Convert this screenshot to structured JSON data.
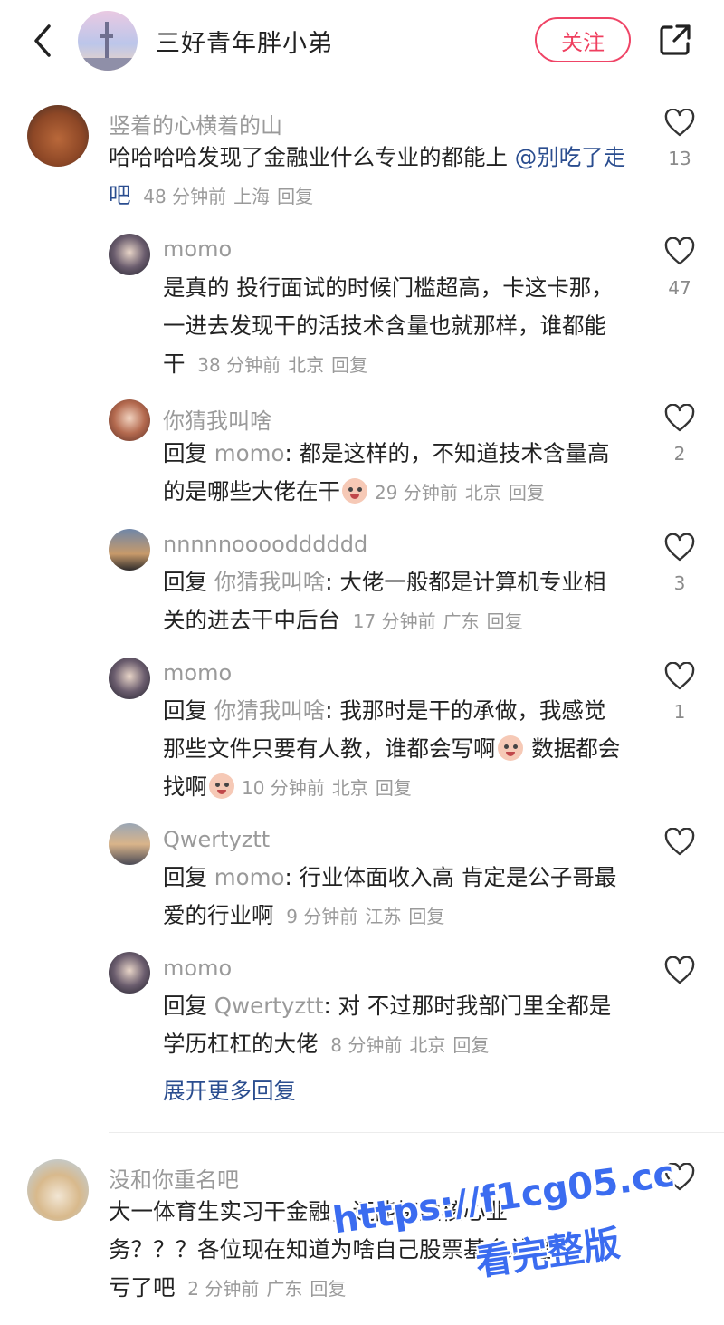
{
  "header": {
    "title": "三好青年胖小弟",
    "follow_label": "关注"
  },
  "comments": [
    {
      "name": "竖着的心横着的山",
      "text": "哈哈哈哈发现了金融业什么专业的都能上",
      "mention": "@别吃了走吧",
      "time": "48 分钟前",
      "location": "上海",
      "reply": "回复",
      "likes": "13"
    }
  ],
  "replies": [
    {
      "name": "momo",
      "text": "是真的 投行面试的时候门槛超高，卡这卡那，一进去发现干的活技术含量也就那样，谁都能干",
      "time": "38 分钟前",
      "location": "北京",
      "reply": "回复",
      "likes": "47"
    },
    {
      "name": "你猜我叫啥",
      "prefix": "回复",
      "target": "momo",
      "text": ": 都是这样的，不知道技术含量高的是哪些大佬在干",
      "time": "29 分钟前",
      "location": "北京",
      "reply": "回复",
      "likes": "2"
    },
    {
      "name": "nnnnnoooodddddd",
      "prefix": "回复",
      "target": "你猜我叫啥",
      "text": ": 大佬一般都是计算机专业相关的进去干中后台",
      "time": "17 分钟前",
      "location": "广东",
      "reply": "回复",
      "likes": "3"
    },
    {
      "name": "momo",
      "prefix": "回复",
      "target": "你猜我叫啥",
      "text": ": 我那时是干的承做，我感觉那些文件只要有人教，谁都会写啊",
      "text2": " 数据都会找啊",
      "time": "10 分钟前",
      "location": "北京",
      "reply": "回复",
      "likes": "1"
    },
    {
      "name": "Qwertyztt",
      "prefix": "回复",
      "target": "momo",
      "text": ": 行业体面收入高 肯定是公子哥最爱的行业啊",
      "time": "9 分钟前",
      "location": "江苏",
      "reply": "回复"
    },
    {
      "name": "momo",
      "prefix": "回复",
      "target": "Qwertyztt",
      "text": ": 对 不过那时我部门里全都是学历杠杠的大佬",
      "time": "8 分钟前",
      "location": "北京",
      "reply": "回复"
    }
  ],
  "more_replies": "展开更多回复",
  "comment2": {
    "name": "没和你重名吧",
    "text": "大一体育生实习干金融，还能接触核心业务？？？各位现在知道为啥自己股票基金总是亏了吧",
    "time": "2 分钟前",
    "location": "广东",
    "reply": "回复"
  },
  "watermark": {
    "url": "https://f1cg05.cc",
    "sub": "看完整版"
  },
  "colors": {
    "accent": "#ef3f5f",
    "link": "#2a4d8f",
    "meta": "#9a9a9a"
  },
  "icons": [
    "back-arrow-icon",
    "share-icon",
    "heart-icon"
  ]
}
